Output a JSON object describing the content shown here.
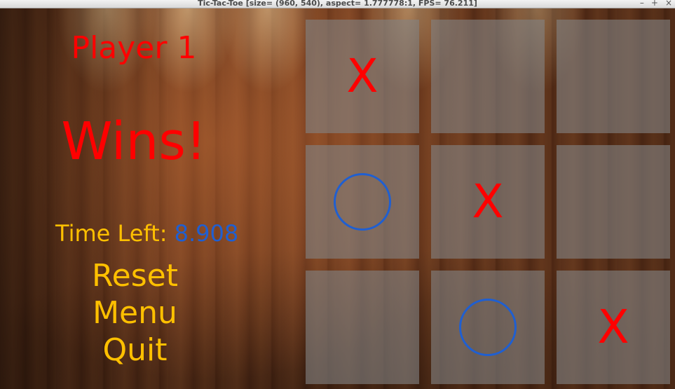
{
  "window": {
    "title": "Tic-Tac-Toe [size= (960, 540), aspect= 1.777778:1, FPS= 76.211]",
    "controls": [
      "–",
      "+",
      "×"
    ]
  },
  "game": {
    "player_label": "Player 1",
    "result_label": "Wins!",
    "timer_label": "Time Left:",
    "timer_value": "8.908",
    "menu": [
      "Reset",
      "Menu",
      "Quit"
    ]
  },
  "board": {
    "cells": [
      "X",
      "",
      "",
      "O",
      "X",
      "",
      "",
      "O",
      "X"
    ]
  },
  "colors": {
    "x_mark": "#ff0000",
    "o_mark": "#1f5fd1",
    "text_accent": "#ffc000",
    "result_text": "#ff0000",
    "timer_value": "#1f5fd1"
  },
  "icons": {
    "minimize": "minimize-icon",
    "maximize": "maximize-icon",
    "close": "close-icon"
  }
}
